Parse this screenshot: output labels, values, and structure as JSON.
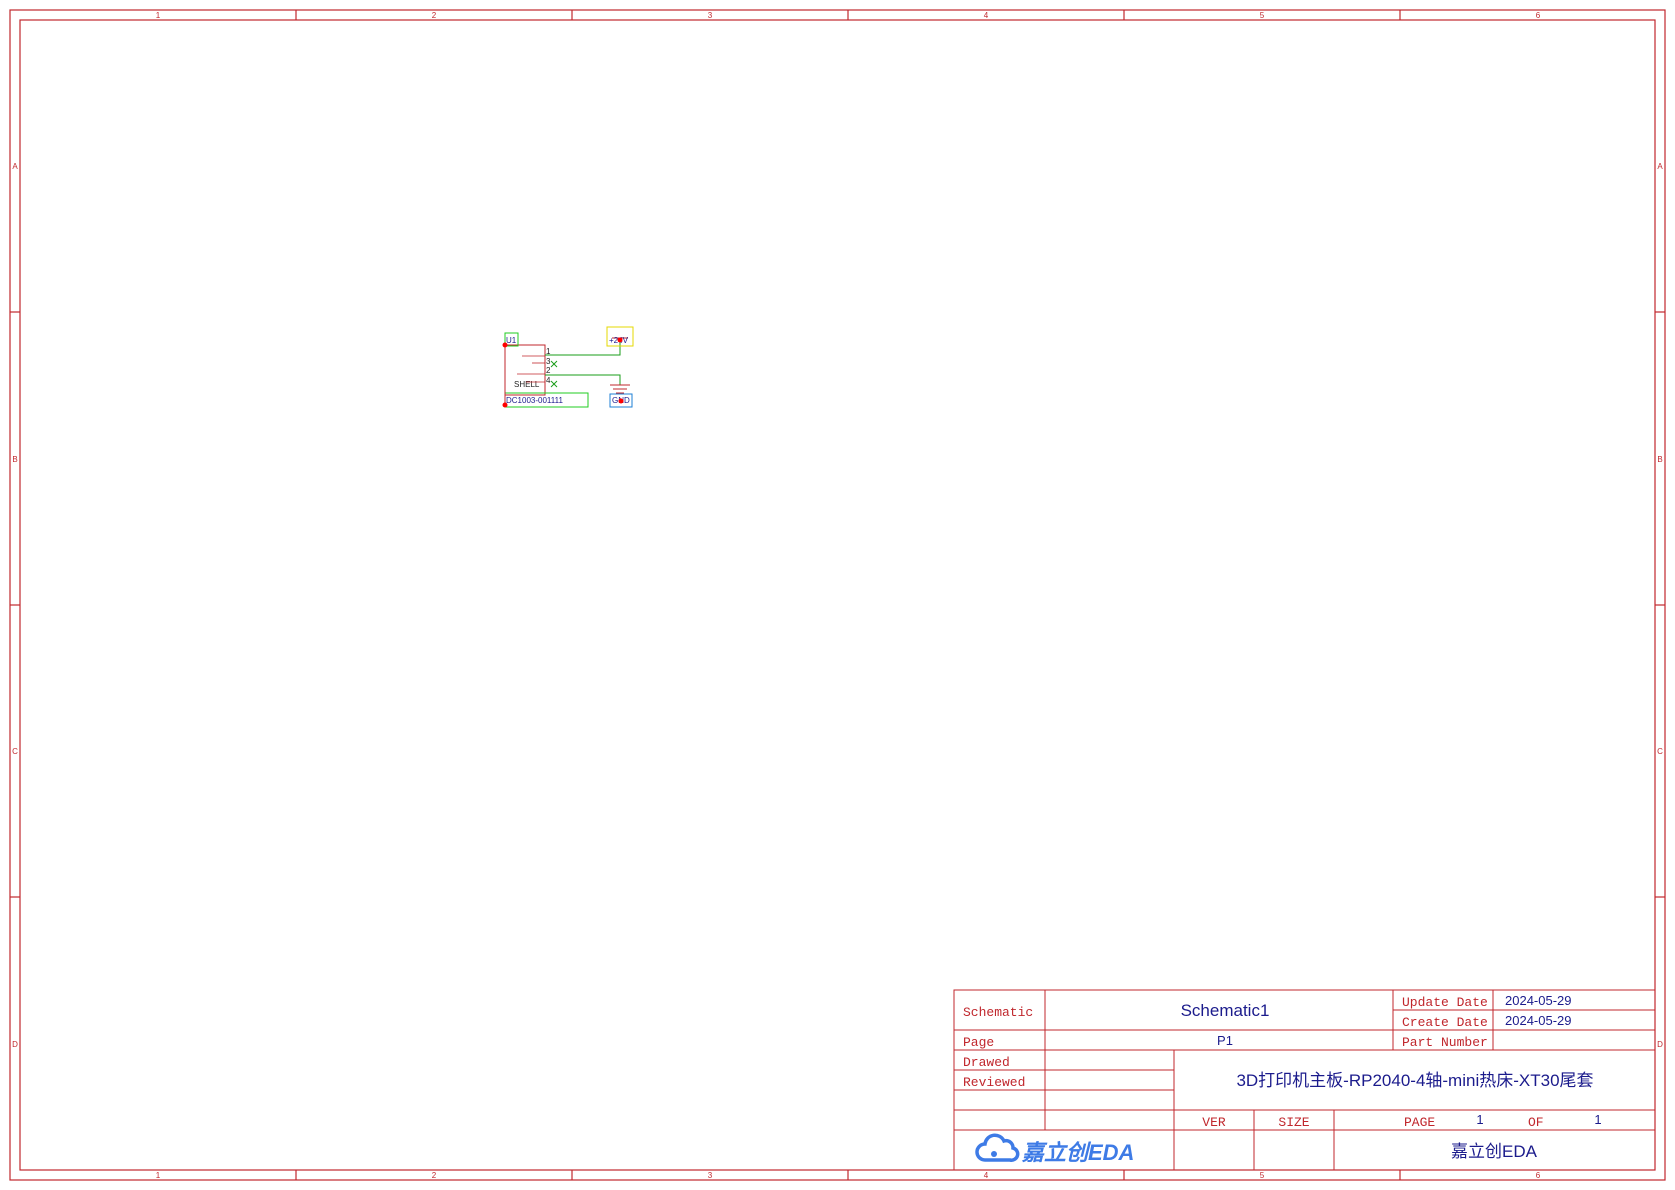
{
  "frame": {
    "columns": [
      "1",
      "2",
      "3",
      "4",
      "5",
      "6"
    ],
    "rows": [
      "A",
      "B",
      "C",
      "D"
    ]
  },
  "circuit": {
    "designator": "U1",
    "part_value": "DC1003-001111",
    "shell_label": "SHELL",
    "pin_numbers": [
      "1",
      "3",
      "2",
      "4"
    ],
    "power_net": "+24V",
    "ground_net": "GND"
  },
  "title_block": {
    "schematic_label": "Schematic",
    "schematic_name": "Schematic1",
    "page_label": "Page",
    "page_value": "P1",
    "drawed_label": "Drawed",
    "reviewed_label": "Reviewed",
    "update_date_label": "Update Date",
    "update_date": "2024-05-29",
    "create_date_label": "Create Date",
    "create_date": "2024-05-29",
    "part_number_label": "Part Number",
    "part_number": "",
    "project_title": "3D打印机主板-RP2040-4轴-mini热床-XT30尾套",
    "ver_label": "VER",
    "size_label": "SIZE",
    "page_word": "PAGE",
    "page_num": "1",
    "of_label": "OF",
    "page_total": "1",
    "logo_text": "嘉立创EDA",
    "company": "嘉立创EDA"
  },
  "colors": {
    "frame": "#c0272d",
    "wire": "#1a9c1a",
    "text_blue": "#1b1b8c",
    "junction": "#ff0000",
    "logo": "#3e7be6",
    "power_box": "#e6d800",
    "gnd_box": "#1e7fd6"
  }
}
